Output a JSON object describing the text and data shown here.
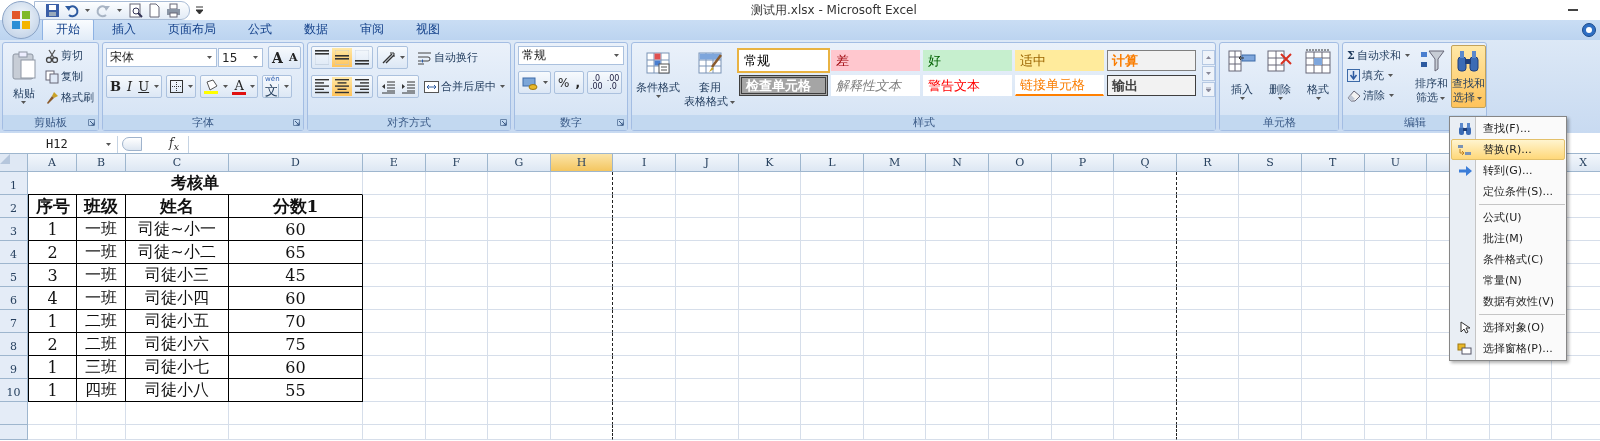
{
  "window": {
    "title": "测试用.xlsx - Microsoft Excel"
  },
  "tabs": [
    {
      "label": "开始",
      "selected": true
    },
    {
      "label": "插入",
      "selected": false
    },
    {
      "label": "页面布局",
      "selected": false
    },
    {
      "label": "公式",
      "selected": false
    },
    {
      "label": "数据",
      "selected": false
    },
    {
      "label": "审阅",
      "selected": false
    },
    {
      "label": "视图",
      "selected": false
    }
  ],
  "ribbon": {
    "clipboard": {
      "label": "剪贴板",
      "paste": "粘贴",
      "cut": "剪切",
      "copy": "复制",
      "format_painter": "格式刷"
    },
    "font": {
      "label": "字体",
      "font_name": "宋体",
      "font_size": "15",
      "grow": "A",
      "shrink": "A",
      "bold": "B",
      "italic": "I",
      "underline": "U",
      "font_color": "A",
      "phonetic_top": "wén",
      "phonetic_char": "文"
    },
    "alignment": {
      "label": "对齐方式",
      "vertical": [
        {
          "kind": "top",
          "selected": false
        },
        {
          "kind": "middle",
          "selected": true
        },
        {
          "kind": "bottom",
          "selected": false
        }
      ],
      "horizontal": [
        {
          "kind": "left",
          "selected": false
        },
        {
          "kind": "center",
          "selected": true
        },
        {
          "kind": "right",
          "selected": false
        }
      ],
      "wrap_text": "自动换行",
      "merge_center": "合并后居中"
    },
    "number": {
      "label": "数字",
      "format": "常规",
      "percent": "%",
      "comma": ",",
      "increase_decimal": [
        ".0",
        ".00"
      ],
      "decrease_decimal": [
        ".00",
        ".0"
      ]
    },
    "styles": {
      "label": "样式",
      "conditional_formatting": "条件格式",
      "format_as_table": [
        "套用",
        "表格格式"
      ],
      "gallery": [
        {
          "kind": "normal",
          "label": "常规",
          "selected": true
        },
        {
          "kind": "bad",
          "label": "差",
          "selected": false
        },
        {
          "kind": "good",
          "label": "好",
          "selected": false
        },
        {
          "kind": "neutral",
          "label": "适中",
          "selected": false
        },
        {
          "kind": "calculation",
          "label": "计算",
          "selected": false
        },
        {
          "kind": "check",
          "label": "检查单元格",
          "selected": false
        },
        {
          "kind": "explanatory",
          "label": "解释性文本",
          "selected": false
        },
        {
          "kind": "warning",
          "label": "警告文本",
          "selected": false
        },
        {
          "kind": "linked",
          "label": "链接单元格",
          "selected": false
        },
        {
          "kind": "output",
          "label": "输出",
          "selected": false
        }
      ]
    },
    "cells": {
      "label": "单元格",
      "buttons": [
        {
          "kind": "insert",
          "label": "插入"
        },
        {
          "kind": "delete",
          "label": "删除"
        },
        {
          "kind": "format",
          "label": "格式"
        }
      ]
    },
    "editing": {
      "label": "编辑",
      "autosum_symbol": "Σ",
      "autosum": "自动求和",
      "fill": "填充",
      "clear": "清除",
      "sort_filter": [
        "排序和",
        "筛选"
      ],
      "find_select": {
        "label": [
          "查找和",
          "选择"
        ],
        "open": true
      }
    }
  },
  "formula_bar": {
    "name_box": "H12",
    "function_label": "f$_{x}$"
  },
  "sheet": {
    "columns": [
      {
        "label": "A",
        "selected": false
      },
      {
        "label": "B",
        "selected": false
      },
      {
        "label": "C",
        "selected": false
      },
      {
        "label": "D",
        "selected": false
      },
      {
        "label": "E",
        "selected": false
      },
      {
        "label": "F",
        "selected": false
      },
      {
        "label": "G",
        "selected": false
      },
      {
        "label": "H",
        "selected": true,
        "page_break": true
      },
      {
        "label": "I",
        "selected": false
      },
      {
        "label": "J",
        "selected": false
      },
      {
        "label": "K",
        "selected": false
      },
      {
        "label": "L",
        "selected": false
      },
      {
        "label": "M",
        "selected": false
      },
      {
        "label": "N",
        "selected": false
      },
      {
        "label": "O",
        "selected": false
      },
      {
        "label": "P",
        "selected": false
      },
      {
        "label": "Q",
        "selected": false,
        "page_break": true
      },
      {
        "label": "R",
        "selected": false
      },
      {
        "label": "S",
        "selected": false
      },
      {
        "label": "T",
        "selected": false
      },
      {
        "label": "U",
        "selected": false
      },
      {},
      {},
      {
        "label": "X",
        "selected": false
      }
    ],
    "row_numbers": [
      "1",
      "2",
      "3",
      "4",
      "5",
      "6",
      "7",
      "8",
      "9",
      "10"
    ],
    "title": "考核单",
    "header": [
      "序号",
      "班级",
      "姓名",
      "分数1"
    ],
    "rows": [
      [
        "1",
        "一班",
        "司徒~小一",
        "60"
      ],
      [
        "2",
        "一班",
        "司徒~小二",
        "65"
      ],
      [
        "3",
        "一班",
        "司徒小三",
        "45"
      ],
      [
        "4",
        "一班",
        "司徒小四",
        "60"
      ],
      [
        "1",
        "二班",
        "司徒小五",
        "70"
      ],
      [
        "2",
        "二班",
        "司徒小六",
        "75"
      ],
      [
        "1",
        "三班",
        "司徒小七",
        "60"
      ],
      [
        "1",
        "四班",
        "司徒小八",
        "55"
      ]
    ]
  },
  "menu": {
    "items": [
      {
        "kind": "find",
        "label": "查找(F)...",
        "selected": false
      },
      {
        "kind": "replace",
        "label": "替换(R)...",
        "selected": true
      },
      {
        "kind": "goto",
        "label": "转到(G)...",
        "selected": false
      },
      {
        "kind": "plain",
        "label": "定位条件(S)...",
        "selected": false
      },
      {
        "kind": "separator"
      },
      {
        "kind": "plain",
        "label": "公式(U)",
        "selected": false
      },
      {
        "kind": "plain",
        "label": "批注(M)",
        "selected": false
      },
      {
        "kind": "plain",
        "label": "条件格式(C)",
        "selected": false
      },
      {
        "kind": "plain",
        "label": "常量(N)",
        "selected": false
      },
      {
        "kind": "plain",
        "label": "数据有效性(V)",
        "selected": false
      },
      {
        "kind": "separator"
      },
      {
        "kind": "select_objects",
        "label": "选择对象(O)",
        "selected": false
      },
      {
        "kind": "selection_pane",
        "label": "选择窗格(P)...",
        "selected": false
      }
    ]
  }
}
